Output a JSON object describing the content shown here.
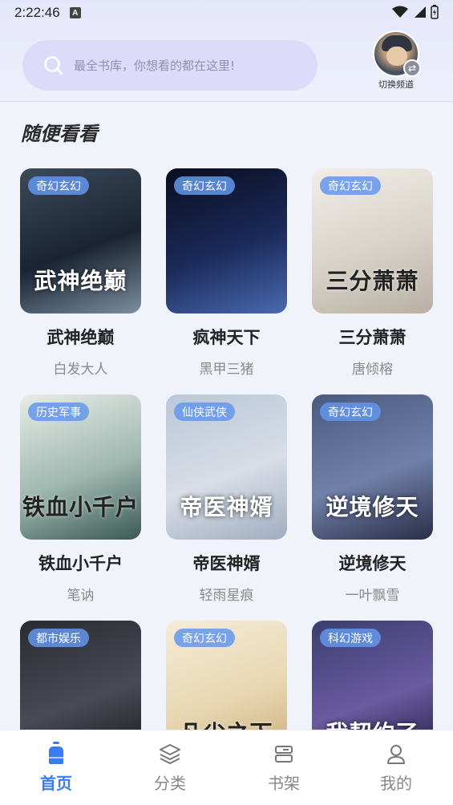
{
  "status": {
    "time": "2:22:46",
    "a_icon": "A"
  },
  "search": {
    "placeholder": "最全书库，你想看的都在这里!"
  },
  "profile": {
    "label": "切换频道"
  },
  "section": {
    "title": "随便看看"
  },
  "books": [
    {
      "tag": "奇幻玄幻",
      "name": "武神绝巅",
      "author": "白发大人",
      "cover_text": "武神绝巅",
      "colors": [
        "#3c4a5a",
        "#1a2433",
        "#7b8fa0"
      ]
    },
    {
      "tag": "奇幻玄幻",
      "name": "疯神天下",
      "author": "黑甲三猪",
      "cover_text": "",
      "colors": [
        "#0a0e1e",
        "#1a2a5a",
        "#4a6ab0"
      ]
    },
    {
      "tag": "奇幻玄幻",
      "name": "三分萧萧",
      "author": "唐倾榕",
      "cover_text": "三分萧萧",
      "colors": [
        "#f1eee9",
        "#d8d2c8",
        "#b8b0a4"
      ]
    },
    {
      "tag": "历史军事",
      "name": "铁血小千户",
      "author": "笔讷",
      "cover_text": "铁血小千户",
      "colors": [
        "#e8ece8",
        "#9fb8b0",
        "#3a5a52"
      ]
    },
    {
      "tag": "仙侠武侠",
      "name": "帝医神婿",
      "author": "轻雨星痕",
      "cover_text": "帝医神婿",
      "colors": [
        "#b9c8d8",
        "#d8dde6",
        "#a0aec0"
      ]
    },
    {
      "tag": "奇幻玄幻",
      "name": "逆境修天",
      "author": "一叶飘雪",
      "cover_text": "逆境修天",
      "colors": [
        "#4a5a80",
        "#7080a8",
        "#2a2e48"
      ]
    },
    {
      "tag": "都市娱乐",
      "name": "",
      "author": "",
      "cover_text": "",
      "colors": [
        "#2a2a32",
        "#4a4a55",
        "#15151a"
      ]
    },
    {
      "tag": "奇幻玄幻",
      "name": "",
      "author": "",
      "cover_text": "凡尘之下",
      "colors": [
        "#f4ecd8",
        "#e8d6b0",
        "#c8a878"
      ]
    },
    {
      "tag": "科幻游戏",
      "name": "",
      "author": "",
      "cover_text": "我契约了",
      "colors": [
        "#3a3e70",
        "#6a5aa0",
        "#1a1a3a"
      ]
    }
  ],
  "nav": {
    "items": [
      {
        "label": "首页",
        "icon": "home-icon",
        "active": true
      },
      {
        "label": "分类",
        "icon": "layers-icon",
        "active": false
      },
      {
        "label": "书架",
        "icon": "bookshelf-icon",
        "active": false
      },
      {
        "label": "我的",
        "icon": "user-icon",
        "active": false
      }
    ]
  },
  "colors": {
    "accent": "#3a7bf0",
    "tag_bg": "#6496eb",
    "search_bg": "#dcdcfa"
  }
}
